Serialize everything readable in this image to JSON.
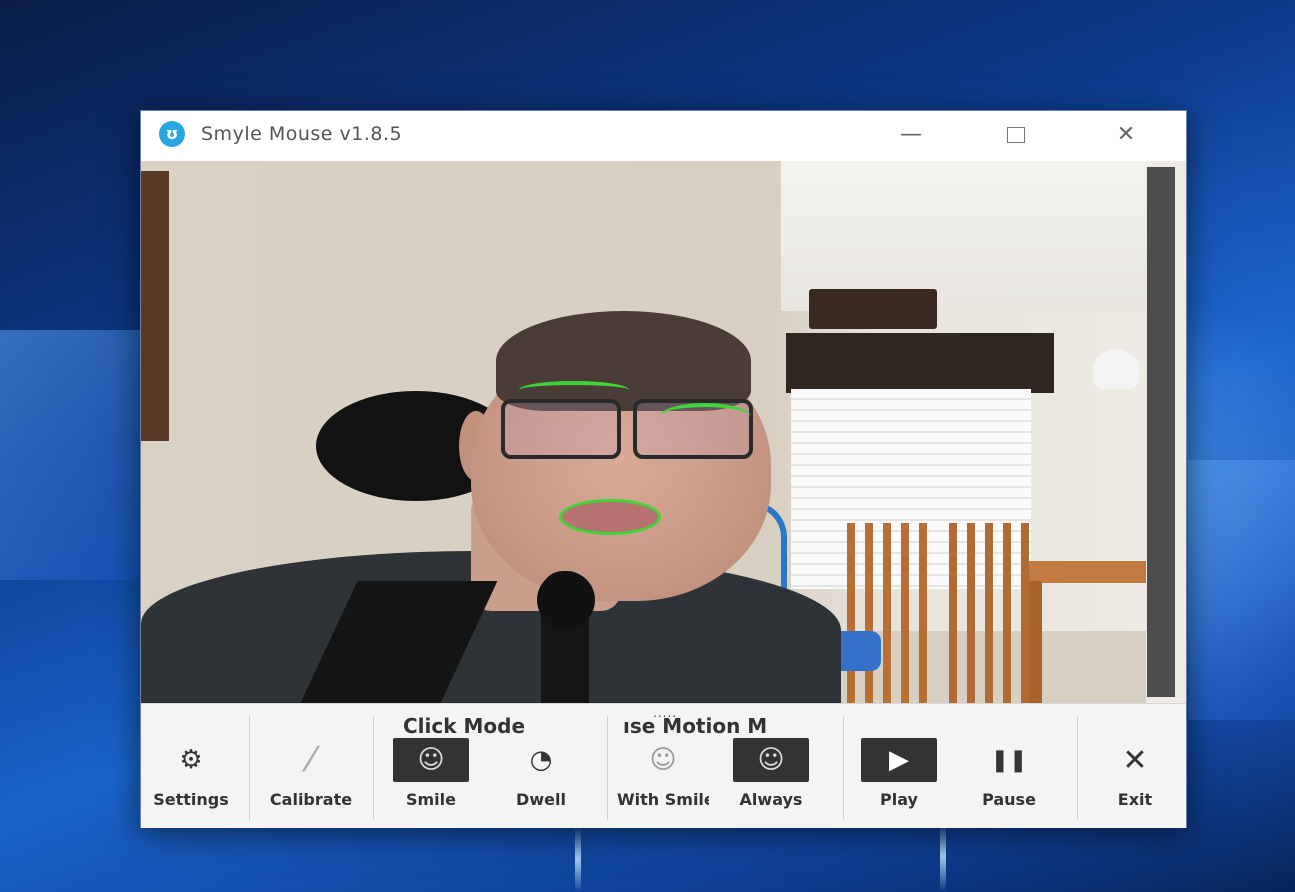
{
  "window": {
    "title": "Smyle Mouse v1.8.5",
    "app_icon": "smyle-app-icon",
    "controls": {
      "minimize_glyph": "—",
      "close_glyph": "✕"
    }
  },
  "toolbar": {
    "grip": ".....",
    "groups": {
      "click_mode": "Click Mode",
      "mouse_motion_mode": "ıse Motion M"
    },
    "buttons": {
      "settings": {
        "label": "Settings",
        "icon": "gear-icon",
        "glyph": "⚙"
      },
      "calibrate": {
        "label": "Calibrate",
        "icon": "ruler-icon",
        "glyph": "⁄"
      },
      "smile": {
        "label": "Smile",
        "icon": "smile-icon",
        "glyph": "☺",
        "active": true
      },
      "dwell": {
        "label": "Dwell",
        "icon": "dwell-icon",
        "glyph": "◔"
      },
      "with_smile": {
        "label": "With Smile",
        "icon": "smile-cursor-icon",
        "glyph": "☺"
      },
      "always": {
        "label": "Always",
        "icon": "always-cursor-icon",
        "glyph": "☺",
        "active": true
      },
      "play": {
        "label": "Play",
        "icon": "play-icon",
        "glyph": "▶",
        "active": true
      },
      "pause": {
        "label": "Pause",
        "icon": "pause-icon",
        "glyph": "❚❚"
      },
      "exit": {
        "label": "Exit",
        "icon": "close-icon",
        "glyph": "✕"
      }
    }
  }
}
